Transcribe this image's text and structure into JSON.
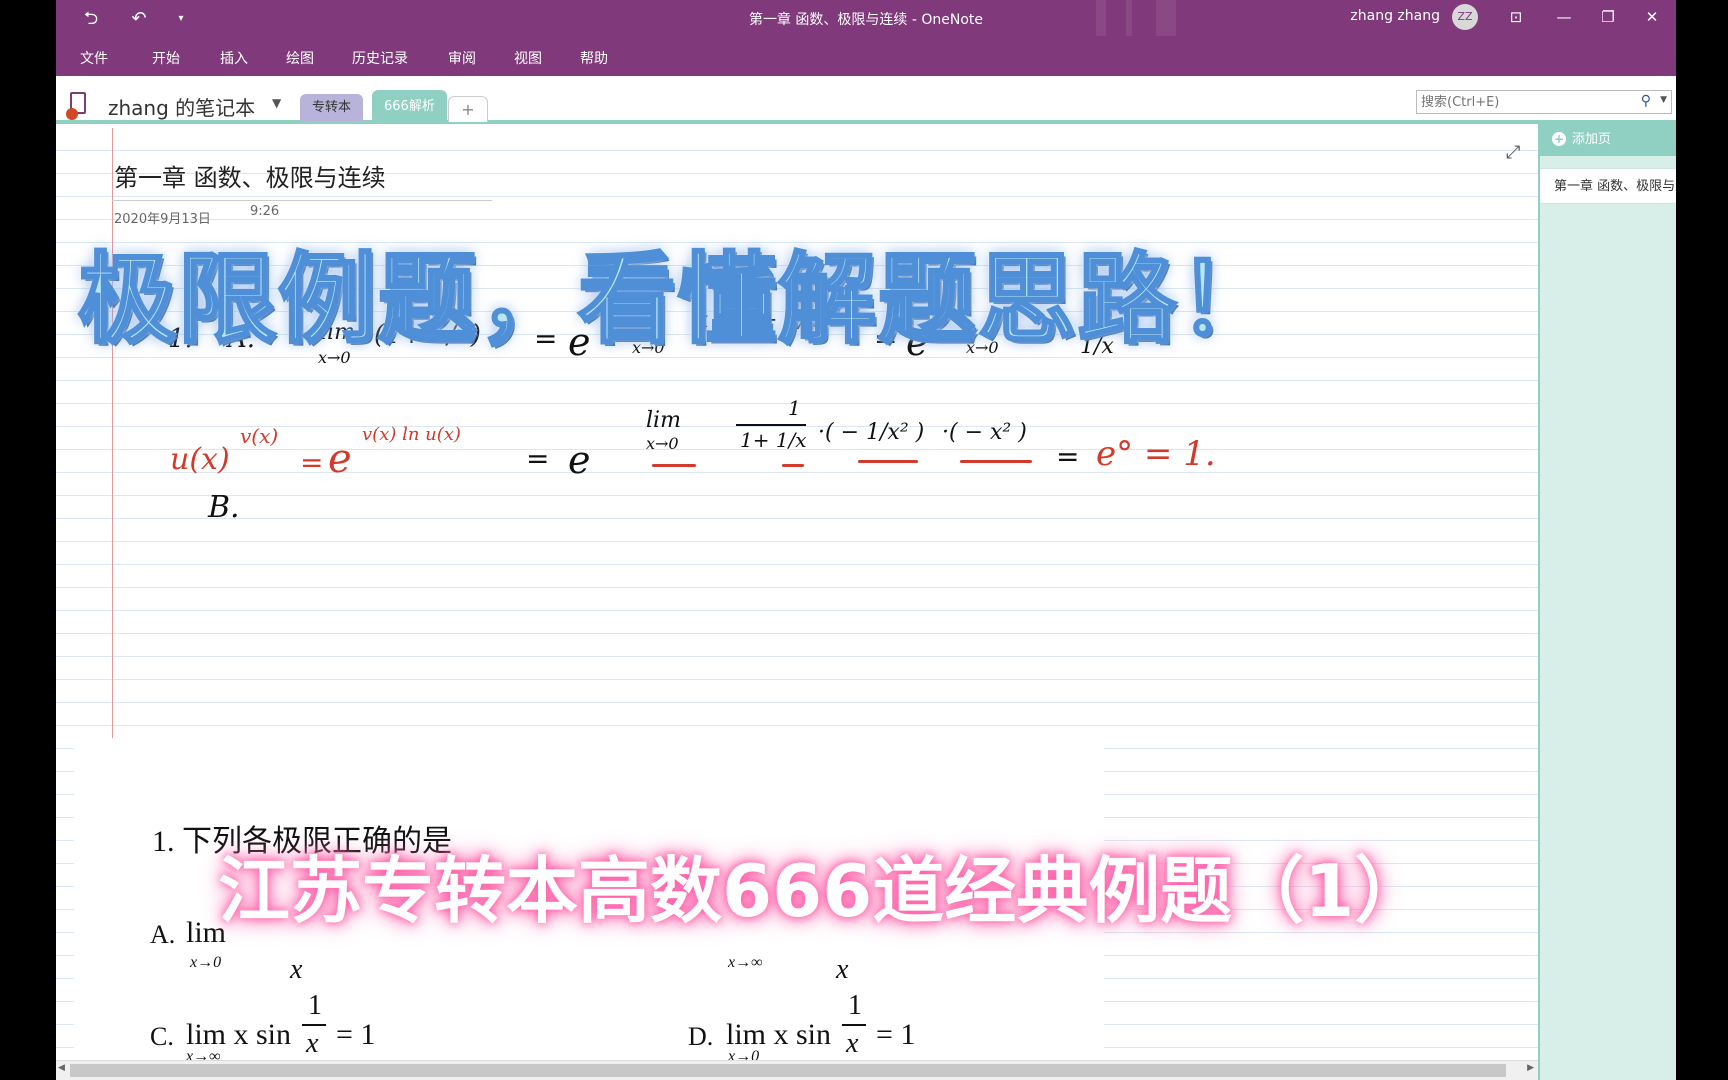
{
  "window": {
    "title": "第一章 函数、极限与连续 - OneNote",
    "user_name": "zhang zhang",
    "user_initials": "ZZ"
  },
  "quick_access": {
    "back_icon": "back-arrow-icon",
    "undo_icon": "undo-icon",
    "customize_icon": "chevron-down-icon"
  },
  "menu": [
    "文件",
    "开始",
    "插入",
    "绘图",
    "历史记录",
    "审阅",
    "视图",
    "帮助"
  ],
  "notebook": {
    "name": "zhang 的笔记本",
    "sections": [
      "专转本",
      "666解析"
    ],
    "add_section": "+"
  },
  "search": {
    "placeholder": "搜索(Ctrl+E)"
  },
  "page": {
    "title": "第一章 函数、极限与连续",
    "date": "2020年9月13日",
    "time": "9:26"
  },
  "handwriting": {
    "line1_label": "1.",
    "line1_option": "A.",
    "line1_lim": "lim",
    "line1_sub": "x→0",
    "line1_expr": "(1+ 1/x)",
    "line1_exp": "x",
    "eq": "=",
    "e": "e",
    "line1_tail": "x ln(1+ 1/x)",
    "line1_sub2": "x→0",
    "line1_frac_den": "1/x",
    "formula_red": "u(x)",
    "formula_red_exp": "v(x)",
    "formula_red_e": "e",
    "formula_red_e_exp": "v(x) ln u(x)",
    "line2_lim": "lim",
    "line2_sub": "x→0",
    "line2_frac_num": "1",
    "line2_frac_den": "1+ 1/x",
    "line2_factor1": "·( − 1/x² )",
    "line2_factor2": "·( − x² )",
    "line2_result": "e° = 1.",
    "option_b": "B."
  },
  "question": {
    "stem": "1. 下列各极限正确的是",
    "a_label": "A.",
    "a_lim": "lim",
    "a_sub": "x→0",
    "a_frac_den": "x",
    "b_sub": "x→∞",
    "b_frac_den": "x",
    "c_label": "C.",
    "c_expr": "lim x sin",
    "c_sub": "x→∞",
    "c_frac_num": "1",
    "c_frac_den": "x",
    "c_rhs": "= 1",
    "d_label": "D.",
    "d_expr": "lim x sin",
    "d_sub": "x→0",
    "d_frac_num": "1",
    "d_frac_den": "x",
    "d_rhs": "= 1"
  },
  "captions": {
    "top": "极限例题，看懂解题思路！",
    "bottom": "江苏专转本高数666道经典例题（1）"
  },
  "page_pane": {
    "add_page": "添加页",
    "pages": [
      "第一章 函数、极限与连续"
    ]
  },
  "colors": {
    "ribbon": "#80397b",
    "section_active": "#8fd0c3",
    "section_inactive": "#b7b3da",
    "ink_red": "#d23b2b"
  }
}
